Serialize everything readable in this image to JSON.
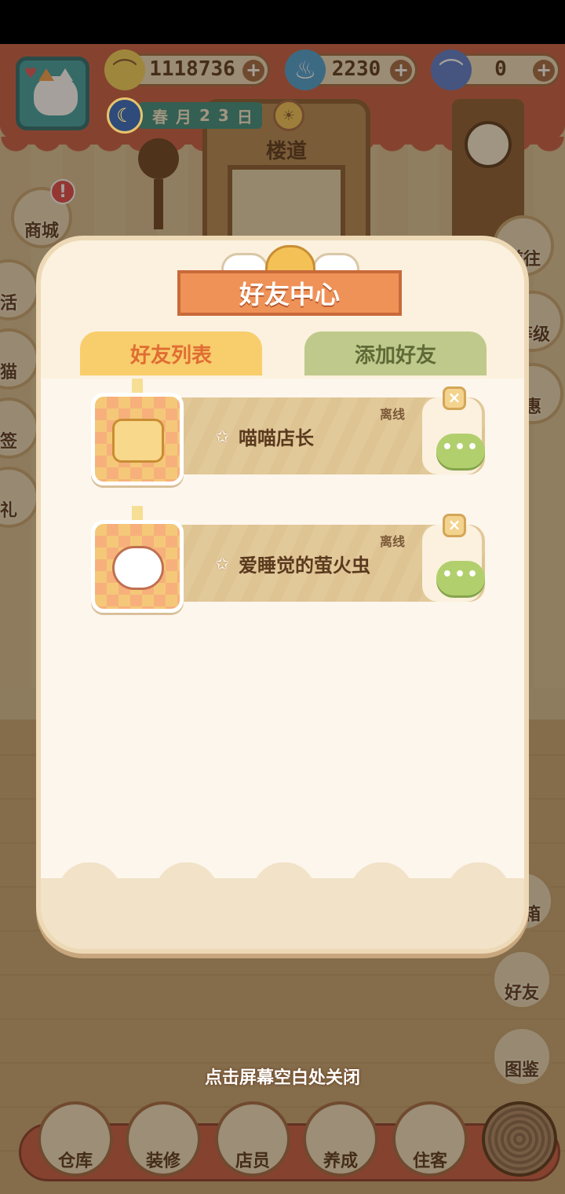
{
  "hud": {
    "resources": [
      {
        "name": "banana-currency",
        "value": "1118736"
      },
      {
        "name": "fire-currency",
        "value": "2230"
      },
      {
        "name": "blue-banana-currency",
        "value": "0"
      }
    ],
    "date": [
      "春",
      "月",
      "2",
      "3",
      "日"
    ]
  },
  "scene": {
    "hallway_sign": "楼道"
  },
  "side_buttons": {
    "left": [
      {
        "label": "商城",
        "badge": "!"
      },
      {
        "label": "活"
      },
      {
        "label": "猫"
      },
      {
        "label": "签"
      },
      {
        "label": "礼"
      }
    ],
    "right": [
      {
        "label": "前往"
      },
      {
        "label": "等级"
      },
      {
        "label": "惠"
      },
      {
        "label": "宝箱"
      },
      {
        "label": "好友"
      },
      {
        "label": "图鉴"
      }
    ]
  },
  "bottom_nav": [
    {
      "label": "仓库"
    },
    {
      "label": "装修"
    },
    {
      "label": "店员"
    },
    {
      "label": "养成"
    },
    {
      "label": "住客"
    }
  ],
  "close_hint": "点击屏幕空白处关闭",
  "dialog": {
    "title": "好友中心",
    "tabs": [
      {
        "label": "好友列表",
        "active": true
      },
      {
        "label": "添加好友",
        "active": false
      }
    ],
    "friends": [
      {
        "name": "喵喵店长",
        "status": "离线",
        "chat": "•••"
      },
      {
        "name": "爱睡觉的萤火虫",
        "status": "离线",
        "chat": "•••"
      }
    ]
  },
  "colors": {
    "ribbon": "#ef9257",
    "tab_active": "#f8cd6b",
    "tab_inactive": "#bfc98c",
    "chat_button": "#b2cf6d"
  }
}
